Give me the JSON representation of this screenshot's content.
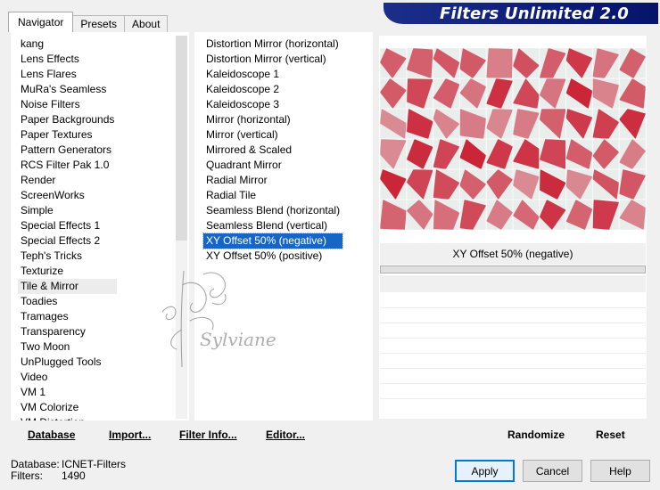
{
  "tabs": [
    {
      "label": "Navigator"
    },
    {
      "label": "Presets"
    },
    {
      "label": "About"
    }
  ],
  "banner": {
    "title": "Filters Unlimited 2.0"
  },
  "categories": [
    "kang",
    "Lens Effects",
    "Lens Flares",
    "MuRa's Seamless",
    "Noise Filters",
    "Paper Backgrounds",
    "Paper Textures",
    "Pattern Generators",
    "RCS Filter Pak 1.0",
    "Render",
    "ScreenWorks",
    "Simple",
    "Special Effects 1",
    "Special Effects 2",
    "Teph's Tricks",
    "Texturize",
    "Tile & Mirror",
    "Toadies",
    "Tramages",
    "Transparency",
    "Two Moon",
    "UnPlugged Tools",
    "Video",
    "VM 1",
    "VM Colorize",
    "VM Distortion"
  ],
  "selected_category": "Tile & Mirror",
  "filters": [
    "Distortion Mirror (horizontal)",
    "Distortion Mirror (vertical)",
    "Kaleidoscope 1",
    "Kaleidoscope 2",
    "Kaleidoscope 3",
    "Mirror (horizontal)",
    "Mirror (vertical)",
    "Mirrored & Scaled",
    "Quadrant Mirror",
    "Radial Mirror",
    "Radial Tile",
    "Seamless Blend (horizontal)",
    "Seamless Blend (vertical)",
    "XY Offset 50% (negative)",
    "XY Offset 50% (positive)"
  ],
  "selected_filter": "XY Offset 50% (negative)",
  "preview": {
    "caption": "XY Offset 50% (negative)"
  },
  "watermark": {
    "text": "Sylviane"
  },
  "bottom_buttons": {
    "database": "Database",
    "import": "Import...",
    "filter_info": "Filter Info...",
    "editor": "Editor...",
    "randomize": "Randomize",
    "reset": "Reset"
  },
  "status": {
    "database_label": "Database:",
    "database_value": "ICNET-Filters",
    "filters_label": "Filters:",
    "filters_value": "1490"
  },
  "dialog_buttons": {
    "apply": "Apply",
    "cancel": "Cancel",
    "help": "Help"
  },
  "colors": {
    "banner": "#0c1c7a",
    "selection": "#1766c7",
    "preview_red": "#c8162a",
    "default_button_border": "#0078d7"
  }
}
